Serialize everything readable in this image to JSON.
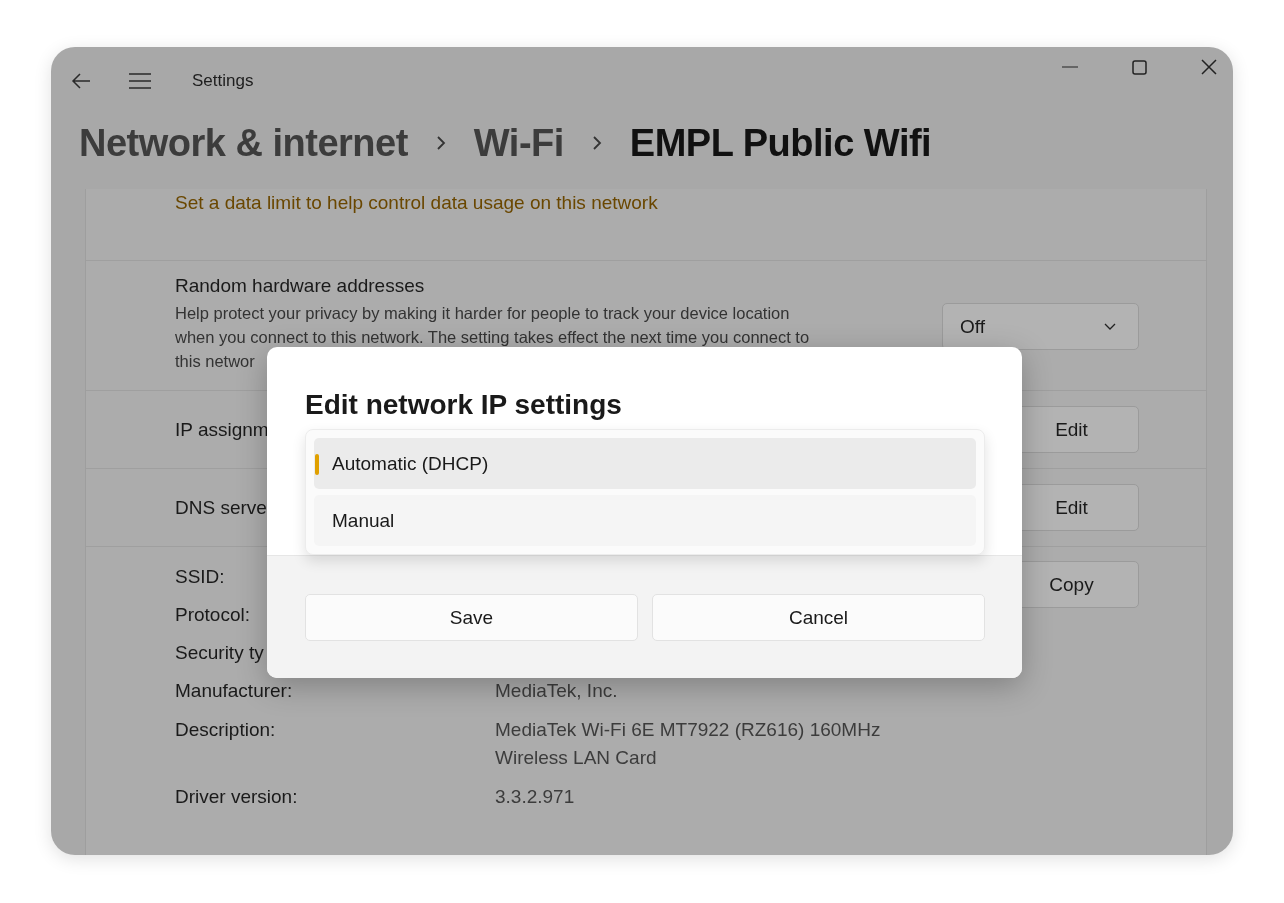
{
  "window": {
    "title": "Settings"
  },
  "breadcrumb": [
    {
      "label": "Network & internet",
      "current": false
    },
    {
      "label": "Wi-Fi",
      "current": false
    },
    {
      "label": "EMPL Public Wifi",
      "current": true
    }
  ],
  "data_limit_link": "Set a data limit to help control data usage on this network",
  "random_hardware": {
    "title": "Random hardware addresses",
    "description_lines": [
      "Help protect your privacy by making it harder for people to track your device location",
      "when you connect to this network. The setting takes effect the next time you connect to",
      "this networ"
    ],
    "dropdown": {
      "value": "Off"
    }
  },
  "rows": [
    {
      "label": "IP assignm",
      "button": "Edit"
    },
    {
      "label": "DNS serve",
      "button": "Edit"
    }
  ],
  "properties": [
    {
      "label": "SSID:"
    },
    {
      "label": "Protocol:"
    },
    {
      "label": "Security ty"
    },
    {
      "label": "Manufacturer:",
      "value_lines": [
        "MediaTek, Inc."
      ]
    },
    {
      "label": "Description:",
      "value_lines": [
        "MediaTek Wi-Fi 6E MT7922 (RZ616) 160MHz",
        "Wireless LAN Card"
      ]
    },
    {
      "label": "Driver version:",
      "value_lines": [
        "3.3.2.971"
      ]
    }
  ],
  "copy_button": "Copy",
  "dialog": {
    "title": "Edit network IP settings",
    "options": [
      {
        "label": "Automatic (DHCP)",
        "selected": true
      },
      {
        "label": "Manual",
        "selected": false
      }
    ],
    "buttons": [
      "Save",
      "Cancel"
    ]
  }
}
